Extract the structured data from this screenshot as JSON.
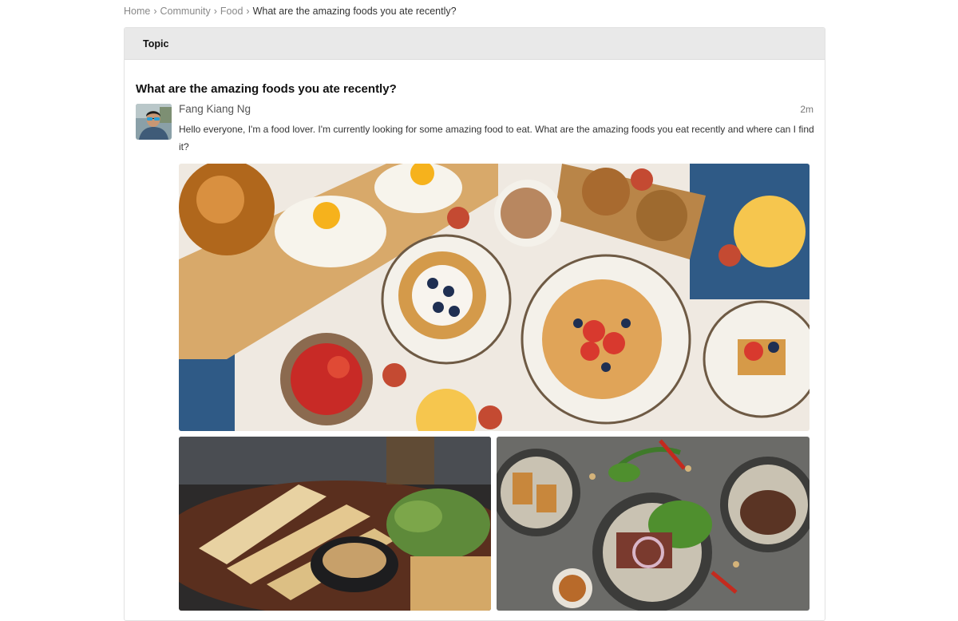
{
  "breadcrumb": {
    "items": [
      "Home",
      "Community",
      "Food"
    ],
    "separator": "›",
    "current": "What are the amazing foods you ate recently?"
  },
  "panel": {
    "header": "Topic"
  },
  "topic": {
    "title": "What are the amazing foods you ate recently?",
    "author": "Fang Kiang Ng",
    "time": "2m",
    "body": "Hello everyone, I'm a food lover. I'm currently looking for some amazing food to eat. What are the amazing foods you eat recently and where can I find it?"
  },
  "images": {
    "main": "breakfast-table-photo",
    "left": "grilled-skewers-photo",
    "right": "steak-salad-bowls-photo"
  },
  "colors": {
    "panel_header_bg": "#e9e9e9",
    "link_gray": "#888888"
  }
}
